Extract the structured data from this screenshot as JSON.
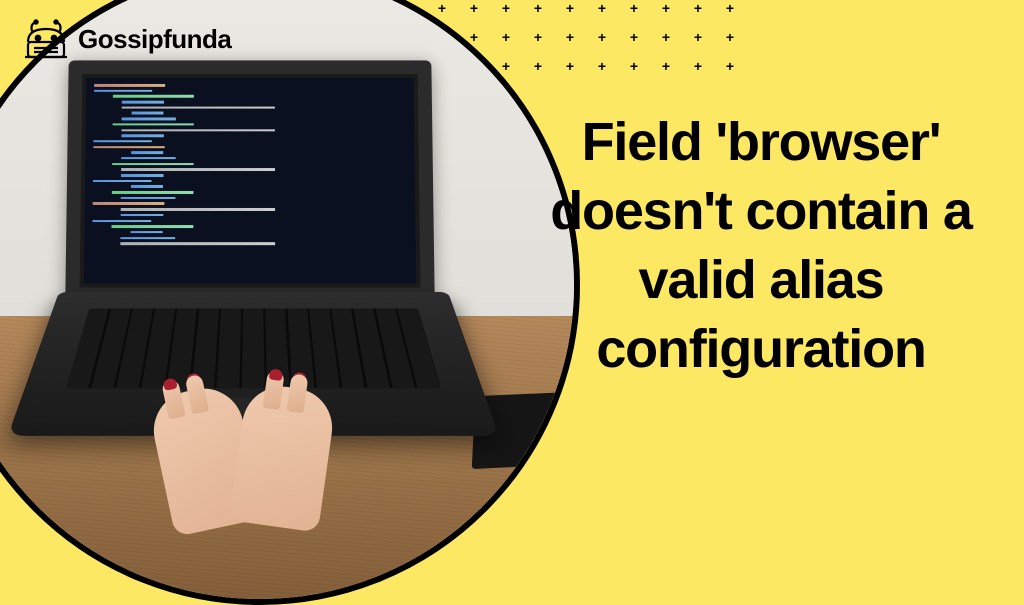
{
  "brand": {
    "name": "Gossipfunda"
  },
  "headline": {
    "text": "Field 'browser' doesn't contain a valid alias configuration"
  },
  "colors": {
    "background": "#fce863",
    "text": "#000000"
  }
}
